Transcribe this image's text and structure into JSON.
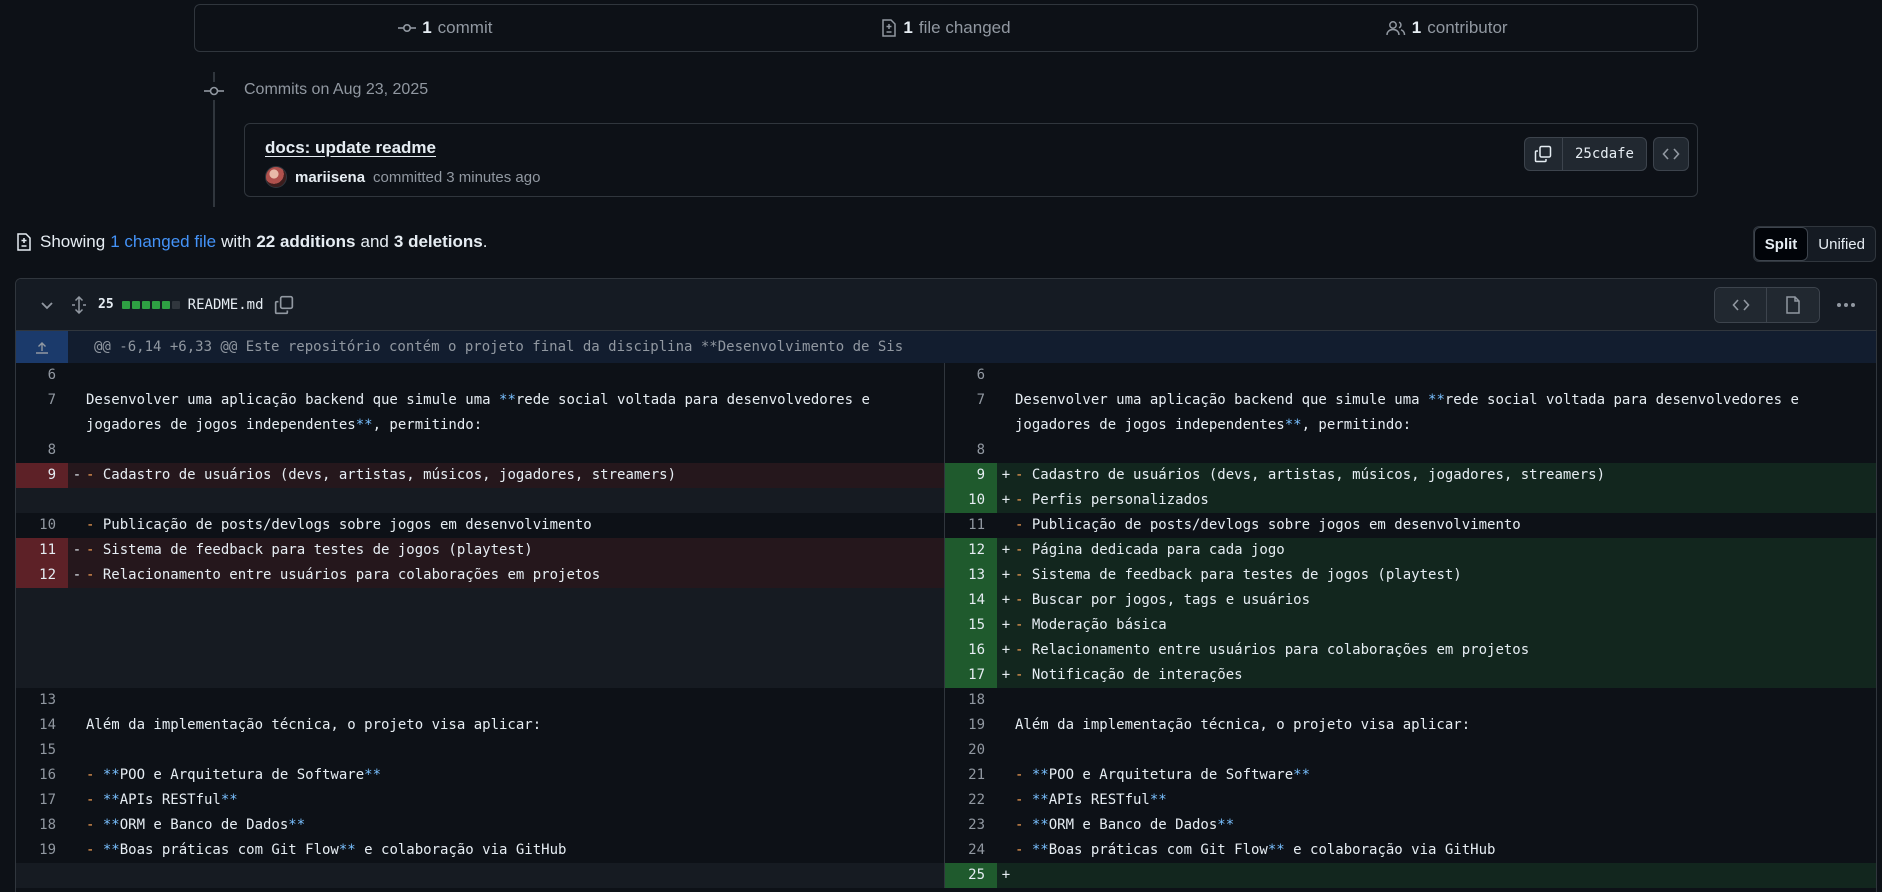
{
  "summary": {
    "commits": {
      "count": "1",
      "label": "commit",
      "icon": "git-commit-icon"
    },
    "files": {
      "count": "1",
      "label": "file changed",
      "icon": "file-diff-icon"
    },
    "contributors": {
      "count": "1",
      "label": "contributor",
      "icon": "people-icon"
    }
  },
  "timeline": {
    "date_label": "Commits on Aug 23, 2025"
  },
  "commit": {
    "title": "docs: update readme",
    "author": "mariisena",
    "action": "committed",
    "time": "3 minutes ago",
    "sha": "25cdafe"
  },
  "showing": {
    "prefix": "Showing",
    "changed_link": "1 changed file",
    "with": "with",
    "additions": "22 additions",
    "and": "and",
    "deletions": "3 deletions",
    "period": "."
  },
  "view_toggle": {
    "split": "Split",
    "unified": "Unified",
    "active": "Split"
  },
  "file": {
    "changes": "25",
    "name": "README.md",
    "diffstat": [
      "#2ea043",
      "#2ea043",
      "#2ea043",
      "#2ea043",
      "#2ea043",
      "#30363d"
    ]
  },
  "hunk_header": "@@ -6,14 +6,33 @@ Este repositório contém o projeto final da disciplina **Desenvolvimento de Sis",
  "colors": {
    "accent": "#4493f8",
    "add_bg": "#12261e",
    "del_bg": "#25171c"
  },
  "diff": {
    "left": [
      {
        "type": "ctx",
        "ln": "6",
        "text": ""
      },
      {
        "type": "ctx",
        "ln": "7",
        "text": "Desenvolver uma aplicação backend que simule uma **rede social voltada para desenvolvedores e jogadores de jogos independentes**, permitindo:",
        "tall": true
      },
      {
        "type": "ctx",
        "ln": "8",
        "text": ""
      },
      {
        "type": "del",
        "ln": "9",
        "text": "- Cadastro de usuários (devs, artistas, músicos, jogadores, streamers)"
      },
      {
        "type": "empty",
        "ln": "",
        "text": ""
      },
      {
        "type": "ctx",
        "ln": "10",
        "text": "- Publicação de posts/devlogs sobre jogos em desenvolvimento"
      },
      {
        "type": "del",
        "ln": "11",
        "text": "- Sistema de feedback para testes de jogos (playtest)"
      },
      {
        "type": "del",
        "ln": "12",
        "text": "- Relacionamento entre usuários para colaborações em projetos"
      },
      {
        "type": "empty",
        "ln": "",
        "text": ""
      },
      {
        "type": "empty",
        "ln": "",
        "text": ""
      },
      {
        "type": "empty",
        "ln": "",
        "text": ""
      },
      {
        "type": "empty",
        "ln": "",
        "text": ""
      },
      {
        "type": "ctx",
        "ln": "13",
        "text": ""
      },
      {
        "type": "ctx",
        "ln": "14",
        "text": "Além da implementação técnica, o projeto visa aplicar:"
      },
      {
        "type": "ctx",
        "ln": "15",
        "text": ""
      },
      {
        "type": "ctx",
        "ln": "16",
        "text": "- **POO e Arquitetura de Software**"
      },
      {
        "type": "ctx",
        "ln": "17",
        "text": "- **APIs RESTful**"
      },
      {
        "type": "ctx",
        "ln": "18",
        "text": "- **ORM e Banco de Dados**"
      },
      {
        "type": "ctx",
        "ln": "19",
        "text": "- **Boas práticas com Git Flow** e colaboração via GitHub"
      },
      {
        "type": "empty",
        "ln": "",
        "text": ""
      }
    ],
    "right": [
      {
        "type": "ctx",
        "ln": "6",
        "text": ""
      },
      {
        "type": "ctx",
        "ln": "7",
        "text": "Desenvolver uma aplicação backend que simule uma **rede social voltada para desenvolvedores e jogadores de jogos independentes**, permitindo:",
        "tall": true
      },
      {
        "type": "ctx",
        "ln": "8",
        "text": ""
      },
      {
        "type": "add",
        "ln": "9",
        "text": "- Cadastro de usuários (devs, artistas, músicos, jogadores, streamers)"
      },
      {
        "type": "add",
        "ln": "10",
        "text": "- Perfis personalizados"
      },
      {
        "type": "ctx",
        "ln": "11",
        "text": "- Publicação de posts/devlogs sobre jogos em desenvolvimento"
      },
      {
        "type": "add",
        "ln": "12",
        "text": "- Página dedicada para cada jogo"
      },
      {
        "type": "add",
        "ln": "13",
        "text": "- Sistema de feedback para testes de jogos (playtest)"
      },
      {
        "type": "add",
        "ln": "14",
        "text": "- Buscar por jogos, tags e usuários"
      },
      {
        "type": "add",
        "ln": "15",
        "text": "- Moderação básica"
      },
      {
        "type": "add",
        "ln": "16",
        "text": "- Relacionamento entre usuários para colaborações em projetos"
      },
      {
        "type": "add",
        "ln": "17",
        "text": "- Notificação de interações"
      },
      {
        "type": "ctx",
        "ln": "18",
        "text": ""
      },
      {
        "type": "ctx",
        "ln": "19",
        "text": "Além da implementação técnica, o projeto visa aplicar:"
      },
      {
        "type": "ctx",
        "ln": "20",
        "text": ""
      },
      {
        "type": "ctx",
        "ln": "21",
        "text": "- **POO e Arquitetura de Software**"
      },
      {
        "type": "ctx",
        "ln": "22",
        "text": "- **APIs RESTful**"
      },
      {
        "type": "ctx",
        "ln": "23",
        "text": "- **ORM e Banco de Dados**"
      },
      {
        "type": "ctx",
        "ln": "24",
        "text": "- **Boas práticas com Git Flow** e colaboração via GitHub"
      },
      {
        "type": "add",
        "ln": "25",
        "text": ""
      }
    ]
  }
}
